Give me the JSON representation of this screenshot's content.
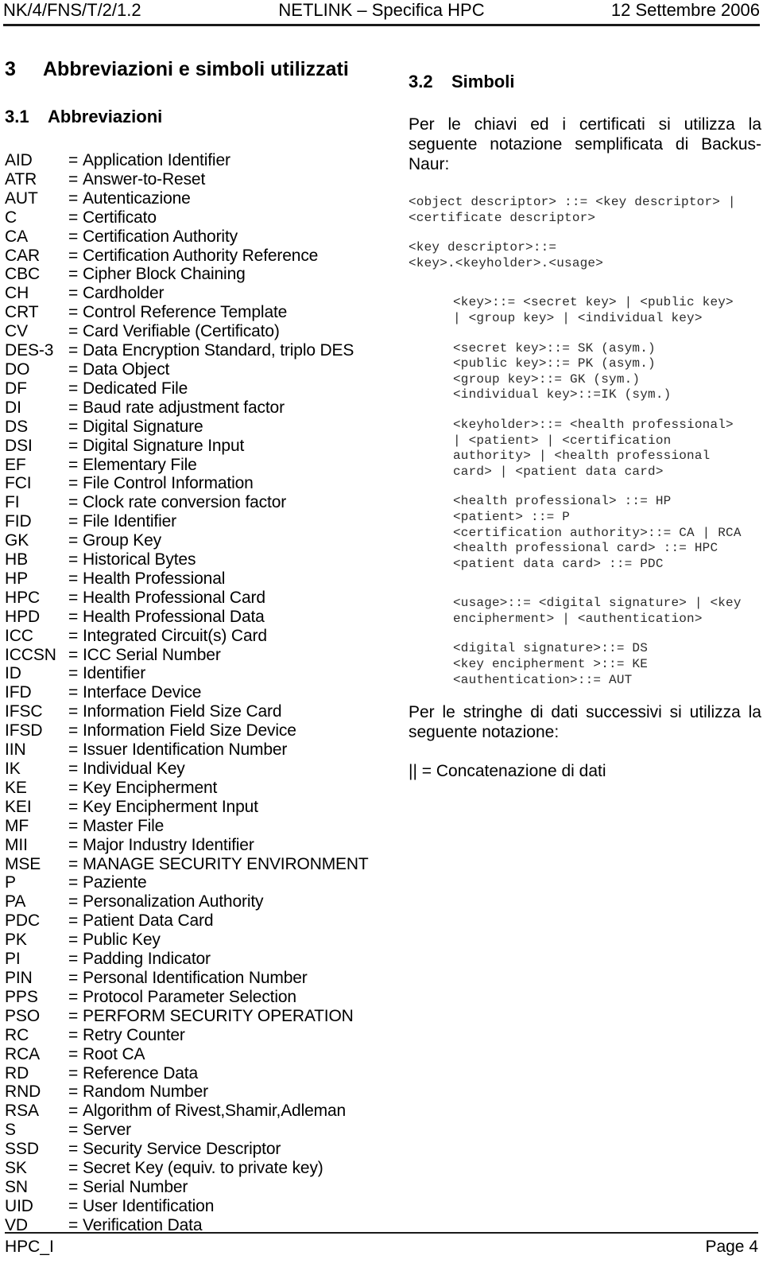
{
  "header": {
    "left": "NK/4/FNS/T/2/1.2",
    "center": "NETLINK – Specifica HPC",
    "right": "12 Settembre 2006"
  },
  "footer": {
    "left": "HPC_I",
    "right": "Page 4"
  },
  "left_column": {
    "section_title": {
      "number": "3",
      "text": "Abbreviazioni e simboli utilizzati"
    },
    "subsection_title": {
      "number": "3.1",
      "text": "Abbreviazioni"
    },
    "equals_sign": "=",
    "abbreviations": [
      {
        "key": "AID",
        "def": "Application Identifier"
      },
      {
        "key": "ATR",
        "def": "Answer-to-Reset"
      },
      {
        "key": "AUT",
        "def": "Autenticazione"
      },
      {
        "key": "C",
        "def": "Certificato"
      },
      {
        "key": "CA",
        "def": "Certification Authority"
      },
      {
        "key": "CAR",
        "def": "Certification Authority Reference"
      },
      {
        "key": "CBC",
        "def": "Cipher Block Chaining"
      },
      {
        "key": "CH",
        "def": "Cardholder"
      },
      {
        "key": "CRT",
        "def": "Control Reference Template"
      },
      {
        "key": "CV",
        "def": "Card Verifiable (Certificato)"
      },
      {
        "key": "DES-3",
        "def": "Data Encryption Standard, triplo DES"
      },
      {
        "key": "DO",
        "def": "Data Object"
      },
      {
        "key": "DF",
        "def": "Dedicated File"
      },
      {
        "key": "DI",
        "def": "Baud rate adjustment factor"
      },
      {
        "key": "DS",
        "def": "Digital Signature"
      },
      {
        "key": "DSI",
        "def": "Digital Signature Input"
      },
      {
        "key": "EF",
        "def": "Elementary File"
      },
      {
        "key": "FCI",
        "def": "File Control Information"
      },
      {
        "key": "FI",
        "def": "Clock rate conversion factor"
      },
      {
        "key": "FID",
        "def": "File Identifier"
      },
      {
        "key": "GK",
        "def": "Group Key"
      },
      {
        "key": "HB",
        "def": "Historical Bytes"
      },
      {
        "key": "HP",
        "def": "Health Professional"
      },
      {
        "key": "HPC",
        "def": "Health Professional Card"
      },
      {
        "key": "HPD",
        "def": "Health Professional Data"
      },
      {
        "key": "ICC",
        "def": "Integrated Circuit(s) Card"
      },
      {
        "key": "ICCSN",
        "def": "ICC Serial Number"
      },
      {
        "key": "ID",
        "def": "Identifier"
      },
      {
        "key": "IFD",
        "def": "Interface Device"
      },
      {
        "key": "IFSC",
        "def": "Information Field Size Card"
      },
      {
        "key": "IFSD",
        "def": "Information Field Size Device"
      },
      {
        "key": "IIN",
        "def": "Issuer Identification Number"
      },
      {
        "key": "IK",
        "def": "Individual Key"
      },
      {
        "key": "KE",
        "def": "Key Encipherment"
      },
      {
        "key": "KEI",
        "def": "Key Encipherment Input"
      },
      {
        "key": "MF",
        "def": "Master File"
      },
      {
        "key": "MII",
        "def": "Major Industry Identifier"
      },
      {
        "key": "MSE",
        "def": "MANAGE SECURITY ENVIRONMENT"
      },
      {
        "key": "P",
        "def": "Paziente"
      },
      {
        "key": "PA",
        "def": "Personalization Authority"
      },
      {
        "key": "PDC",
        "def": "Patient Data Card"
      },
      {
        "key": "PK",
        "def": "Public Key"
      },
      {
        "key": "PI",
        "def": "Padding Indicator"
      },
      {
        "key": "PIN",
        "def": "Personal Identification Number"
      },
      {
        "key": "PPS",
        "def": "Protocol Parameter Selection"
      },
      {
        "key": "PSO",
        "def": "PERFORM SECURITY OPERATION"
      },
      {
        "key": "RC",
        "def": "Retry Counter"
      },
      {
        "key": "RCA",
        "def": "Root CA"
      },
      {
        "key": "RD",
        "def": "Reference Data"
      },
      {
        "key": "RND",
        "def": "Random Number"
      },
      {
        "key": "RSA",
        "def": "Algorithm of Rivest,Shamir,Adleman"
      },
      {
        "key": "S",
        "def": "Server"
      },
      {
        "key": "SSD",
        "def": "Security Service Descriptor"
      },
      {
        "key": "SK",
        "def": "Secret Key (equiv. to private key)"
      },
      {
        "key": "SN",
        "def": "Serial Number"
      },
      {
        "key": "UID",
        "def": "User Identification"
      },
      {
        "key": "VD",
        "def": "Verification Data"
      }
    ]
  },
  "right_column": {
    "subsection_title": {
      "number": "3.2",
      "text": "Simboli"
    },
    "intro_paragraph": "Per le chiavi ed i certificati si utilizza la seguente notazione semplificata di Backus-Naur:",
    "bnf_groups": [
      {
        "indent": false,
        "text": "<object descriptor> ::= <key descriptor> |\n<certificate descriptor>"
      },
      {
        "indent": false,
        "text": "<key descriptor>::=\n<key>.<keyholder>.<usage>"
      },
      {
        "indent": true,
        "text": "<key>::= <secret key> | <public key>\n| <group key> | <individual key>"
      },
      {
        "indent": true,
        "text": "<secret key>::= SK (asym.)\n<public key>::= PK (asym.)\n<group key>::= GK (sym.)\n<individual key>::=IK (sym.)"
      },
      {
        "indent": true,
        "text": "<keyholder>::= <health professional>\n| <patient> | <certification\nauthority> | <health professional\ncard> | <patient data card>"
      },
      {
        "indent": true,
        "text": "<health professional> ::= HP\n<patient> ::= P\n<certification authority>::= CA | RCA\n<health professional card> ::= HPC\n<patient data card> ::= PDC"
      },
      {
        "indent": true,
        "text": "<usage>::= <digital signature> | <key\nencipherment> | <authentication>"
      },
      {
        "indent": true,
        "text": "<digital signature>::= DS\n<key encipherment >::= KE\n<authentication>::= AUT"
      }
    ],
    "closing_paragraph": "Per le stringhe di dati successivi si utilizza la seguente notazione:",
    "concatenation_note": "|| = Concatenazione di dati"
  }
}
